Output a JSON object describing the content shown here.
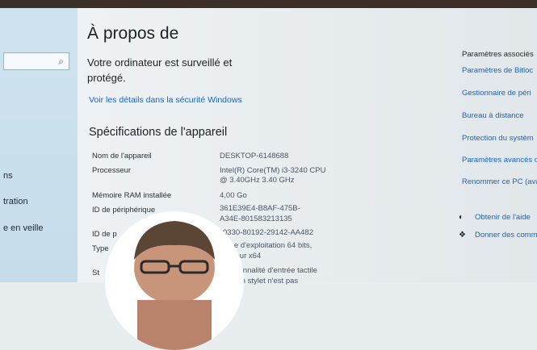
{
  "sidebar": {
    "search": {
      "placeholder": ""
    },
    "items": [
      {
        "label": "ns"
      },
      {
        "label": "tration"
      },
      {
        "label": "e en veille"
      }
    ]
  },
  "main": {
    "title": "À propos de",
    "status": "Votre ordinateur est surveillé et protégé.",
    "security_link": "Voir les détails dans la sécurité Windows",
    "specs_heading": "Spécifications de l'appareil",
    "specs": [
      {
        "label": "Nom de l'appareil",
        "value": "DESKTOP-6148688"
      },
      {
        "label": "Processeur",
        "value": "Intel(R) Core(TM) i3-3240 CPU",
        "value2": "@ 3.40GHz   3.40 GHz"
      },
      {
        "label": "Mémoire RAM installée",
        "value": "4,00 Go"
      },
      {
        "label": "ID de périphérique",
        "value": "361E39E4-B8AF-475B-",
        "value2": "A34E-801583213135"
      },
      {
        "label": "ID de p",
        "value": "0330-80192-29142-AA482"
      },
      {
        "label": "Type",
        "value": "me d'exploitation 64 bits,",
        "value2": "sseur x64"
      },
      {
        "label": "St",
        "value": "ctionnalité d'entrée tactile",
        "value2": "c un stylet n'est pas"
      }
    ]
  },
  "related": {
    "header": "Paramètres associés",
    "links": [
      "Paramètres de Bitloc",
      "Gestionnaire de péri",
      "Bureau à distance",
      "Protection du systèm",
      "Paramètres avancés d",
      "Renommer ce PC (ava"
    ]
  },
  "help": [
    {
      "label": "Obtenir de l'aide",
      "icon": "help-icon"
    },
    {
      "label": "Donner des comm",
      "icon": "feedback-icon"
    }
  ]
}
